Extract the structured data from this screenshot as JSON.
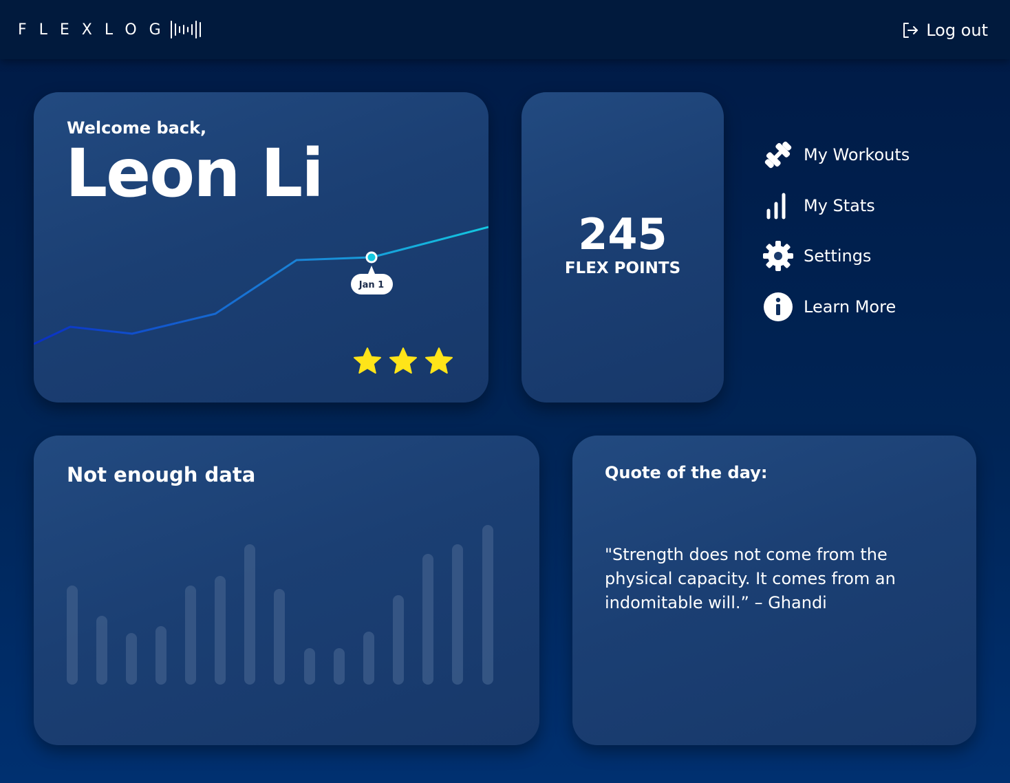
{
  "header": {
    "logo_text": "FLEXLOG",
    "logout_label": "Log out",
    "logout_icon": "logout-icon"
  },
  "welcome": {
    "greeting": "Welcome back,",
    "name": "Leon Li",
    "trend_point_label": "Jan 1",
    "stars": 3,
    "star_color": "#ffe419"
  },
  "points": {
    "value": "245",
    "label": "FLEX POINTS"
  },
  "menu": {
    "items": [
      {
        "label": "My Workouts",
        "icon": "dumbbell-icon"
      },
      {
        "label": "My Stats",
        "icon": "bar-chart-icon"
      },
      {
        "label": "Settings",
        "icon": "gear-icon"
      },
      {
        "label": "Learn More",
        "icon": "info-icon"
      }
    ]
  },
  "activity": {
    "title": "Not enough data"
  },
  "quote": {
    "title": "Quote of the day:",
    "text": "\"Strength does not come from the physical capacity. It comes from an indomitable will.” – Ghandi"
  },
  "colors": {
    "background": "#002455",
    "card": "#1b3f73",
    "line_start": "#0a2fc4",
    "line_end": "#13c8e0",
    "placeholder_bar": "#3a5a88"
  }
}
